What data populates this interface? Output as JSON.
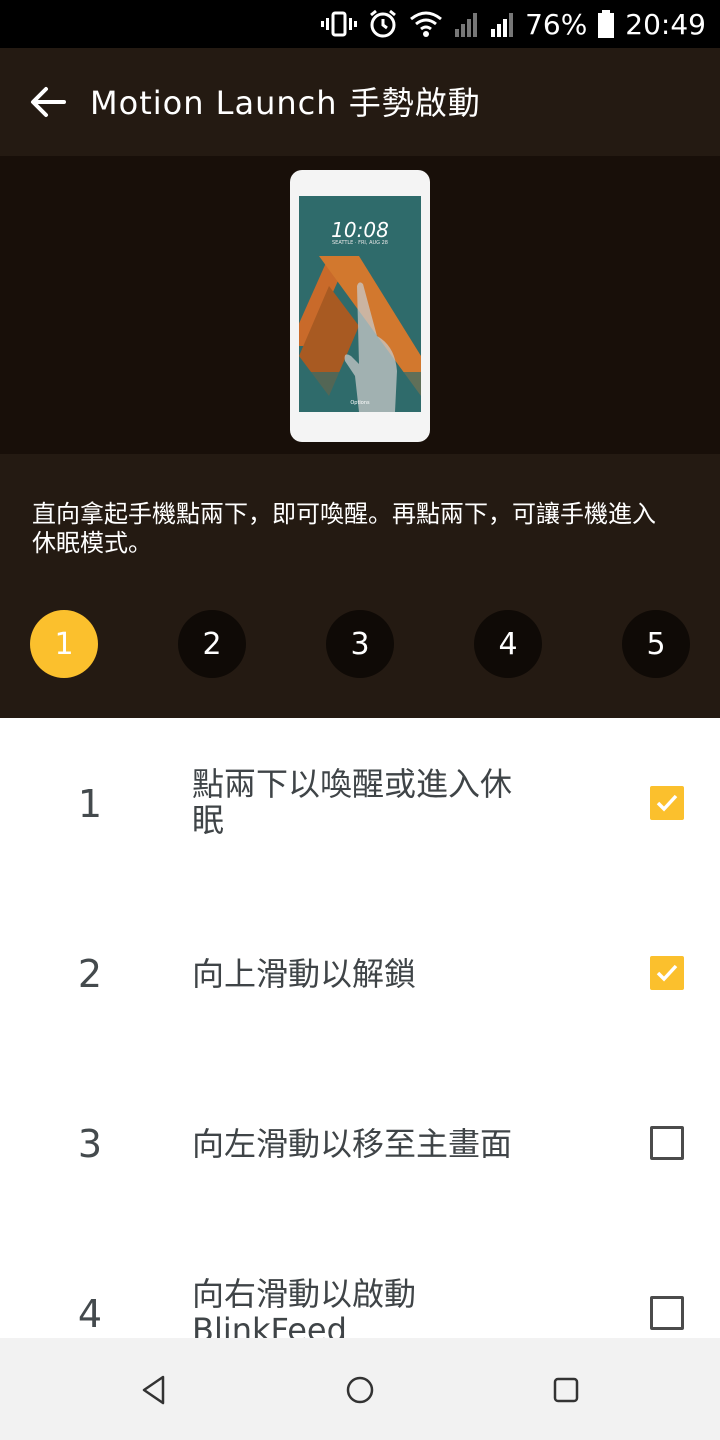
{
  "status_bar": {
    "battery_percent": "76%",
    "time": "20:49",
    "icons": [
      "vibrate-icon",
      "alarm-icon",
      "wifi-icon",
      "signal-icon",
      "signal-icon",
      "battery-icon"
    ]
  },
  "app_bar": {
    "title": "Motion Launch 手勢啟動",
    "back_icon": "arrow-back-icon"
  },
  "illustration": {
    "clock": "10:08",
    "clock_sub": "SEATTLE · FRI, AUG 28",
    "screen_bottom_label": "Options"
  },
  "description": "直向拿起手機點兩下，即可喚醒。再點兩下，可讓手機進入休眠模式。",
  "steps": {
    "labels": [
      "1",
      "2",
      "3",
      "4",
      "5"
    ],
    "active_index": 0,
    "accent_color": "#fbc02d"
  },
  "options": [
    {
      "number": "1",
      "label": "點兩下以喚醒或進入休眠",
      "checked": true
    },
    {
      "number": "2",
      "label": "向上滑動以解鎖",
      "checked": true
    },
    {
      "number": "3",
      "label": "向左滑動以移至主畫面",
      "checked": false
    },
    {
      "number": "4",
      "label": "向右滑動以啟動 BlinkFeed",
      "checked": false
    }
  ],
  "nav_bar": {
    "icons": [
      "back-triangle-icon",
      "home-circle-icon",
      "recents-square-icon"
    ]
  }
}
